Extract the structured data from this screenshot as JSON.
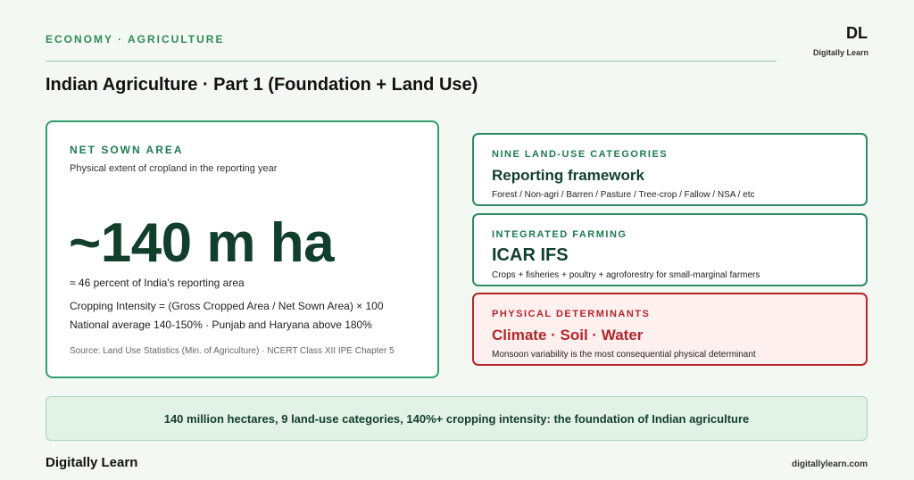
{
  "header": {
    "eyebrow": "ECONOMY · AGRICULTURE",
    "logo_mark": "DL",
    "logo_sub": "Digitally Learn",
    "title": "Indian Agriculture · Part 1 (Foundation + Land Use)"
  },
  "main_card": {
    "label": "NET SOWN AREA",
    "description": "Physical extent of cropland in the reporting year",
    "big_value": "~140 m ha",
    "line1": "≈ 46 percent of India's reporting area",
    "line2": "Cropping Intensity = (Gross Cropped Area / Net Sown Area) × 100",
    "line3": "National average 140-150% · Punjab and Haryana above 180%",
    "source": "Source: Land Use Statistics (Min. of Agriculture) · NCERT Class XII IPE Chapter 5"
  },
  "side_cards": [
    {
      "label": "NINE LAND-USE CATEGORIES",
      "heading": "Reporting framework",
      "description": "Forest / Non-agri / Barren / Pasture / Tree-crop / Fallow / NSA / etc"
    },
    {
      "label": "INTEGRATED FARMING",
      "heading": "ICAR IFS",
      "description": "Crops + fisheries + poultry + agroforestry for small-marginal farmers"
    },
    {
      "label": "PHYSICAL DETERMINANTS",
      "heading": "Climate · Soil · Water",
      "description": "Monsoon variability is the most consequential physical determinant"
    }
  ],
  "banner": {
    "text": "140 million hectares, 9 land-use categories, 140%+ cropping intensity: the foundation of Indian agriculture"
  },
  "footer": {
    "brand": "Digitally Learn",
    "url": "digitallylearn.com"
  },
  "colors": {
    "accent": "#2e9e6e",
    "dark_green": "#123f2c",
    "alert_red": "#b3262a",
    "background": "#f3f8f3"
  }
}
